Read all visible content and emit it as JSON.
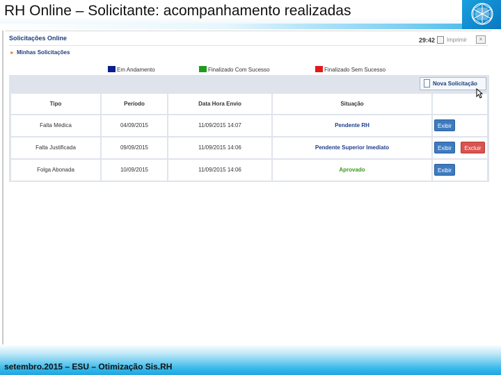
{
  "slide": {
    "title": "RH Online – Solicitante: acompanhamento realizadas",
    "footer": "setembro.2015 – ESU – Otimização Sis.RH"
  },
  "app": {
    "title": "Solicitações Online",
    "time": "29:42",
    "print_label": "Imprimir",
    "breadcrumb": "Minhas Solicitações",
    "legend": [
      {
        "label": "Em Andamento",
        "color": "#0a1f8f"
      },
      {
        "label": "Finalizado Com Sucesso",
        "color": "#1f9b1f"
      },
      {
        "label": "Finalizado Sem Sucesso",
        "color": "#e01b1b"
      }
    ],
    "new_button": "Nova Solicitação",
    "table": {
      "headers": [
        "Tipo",
        "Período",
        "Data Hora Envio",
        "Situação"
      ],
      "rows": [
        {
          "tipo": "Falta Médica",
          "periodo": "04/09/2015",
          "envio": "11/09/2015 14:07",
          "situacao": "Pendente RH",
          "show": "Exibir"
        },
        {
          "tipo": "Falta Justificada",
          "periodo": "09/09/2015",
          "envio": "11/09/2015 14:06",
          "situacao": "Pendente Superior Imediato",
          "show": "Exibir",
          "delete": "Excluir"
        },
        {
          "tipo": "Folga Abonada",
          "periodo": "10/09/2015",
          "envio": "11/09/2015 14:06",
          "situacao": "Aprovado",
          "show": "Exibir"
        }
      ]
    }
  }
}
